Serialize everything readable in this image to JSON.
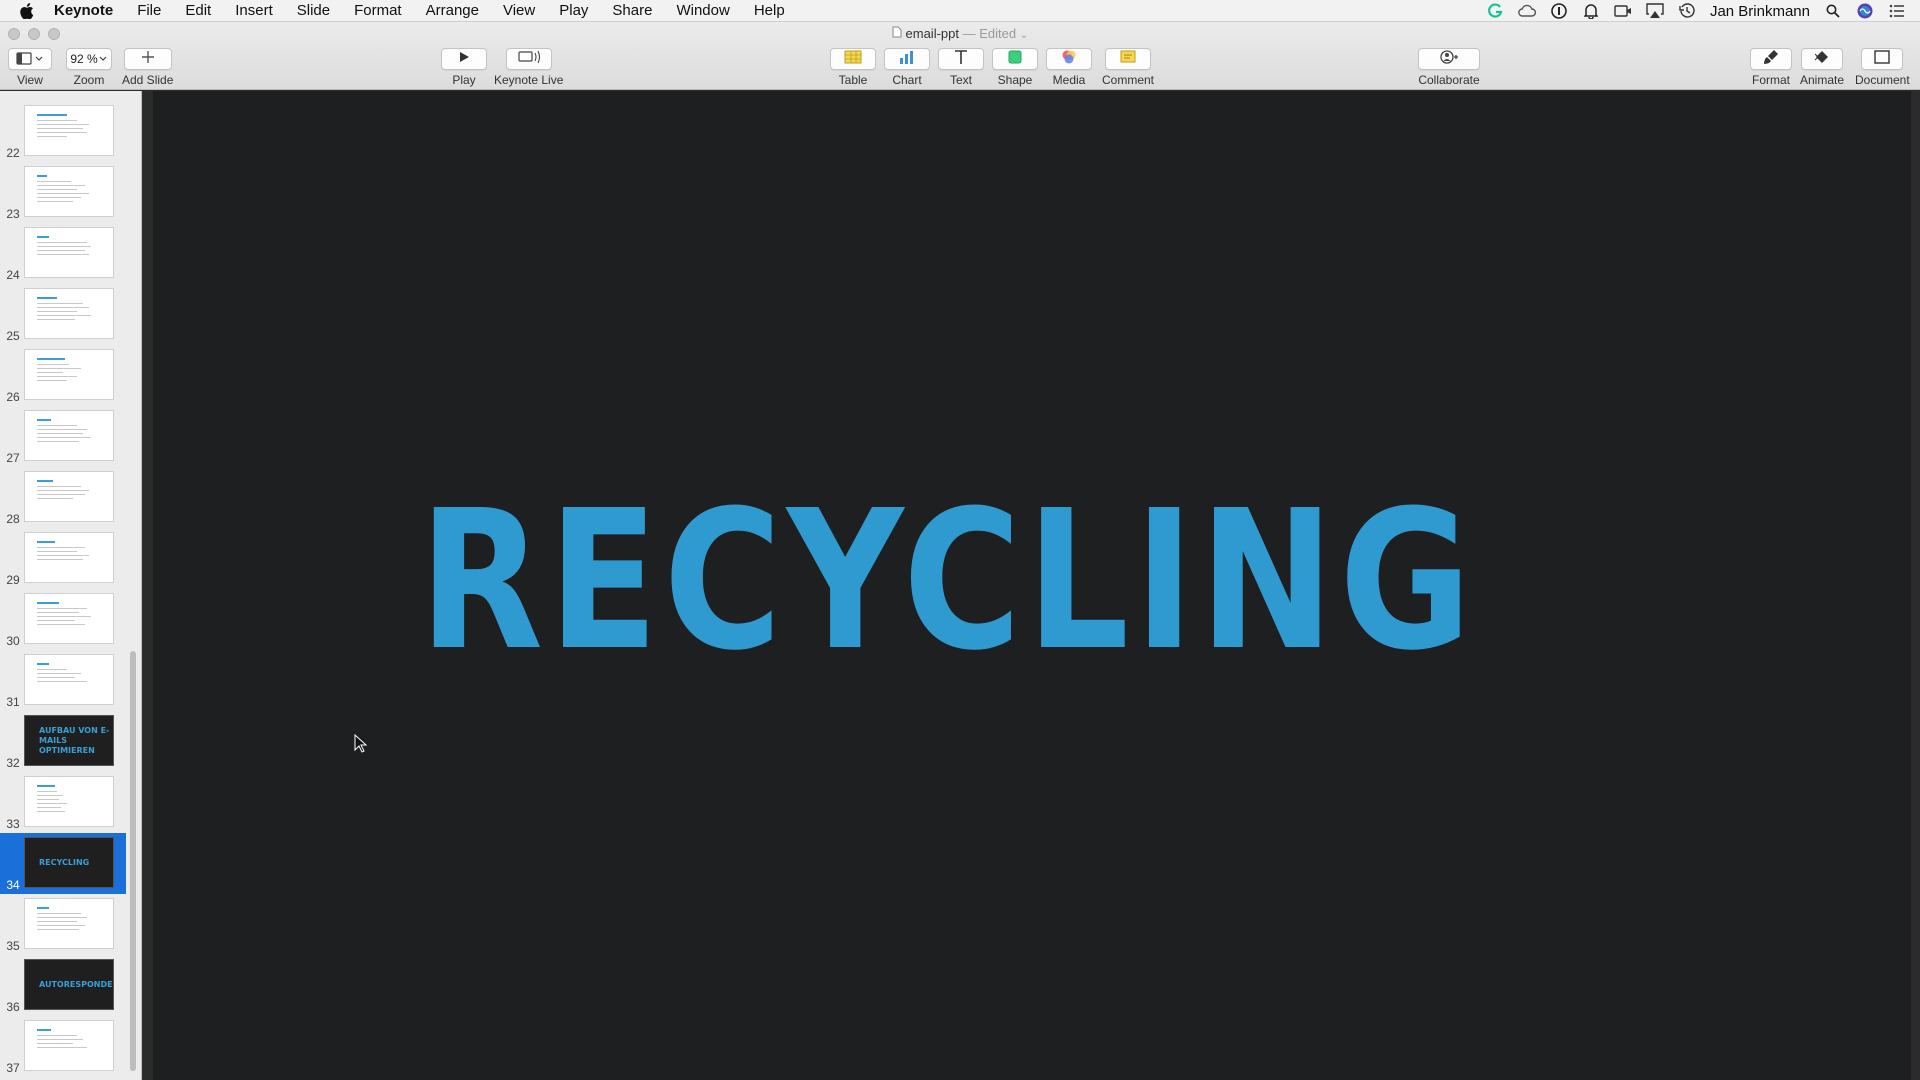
{
  "menubar": {
    "app_name": "Keynote",
    "items": [
      "File",
      "Edit",
      "Insert",
      "Slide",
      "Format",
      "Arrange",
      "View",
      "Play",
      "Share",
      "Window",
      "Help"
    ],
    "user": "Jan Brinkmann"
  },
  "window": {
    "doc_name": "email-ppt",
    "separator": " — ",
    "status": "Edited"
  },
  "toolbar": {
    "view": "View",
    "zoom": "Zoom",
    "zoom_value": "92 %",
    "add_slide": "Add Slide",
    "play": "Play",
    "keynote_live": "Keynote Live",
    "table": "Table",
    "chart": "Chart",
    "text": "Text",
    "shape": "Shape",
    "media": "Media",
    "comment": "Comment",
    "collaborate": "Collaborate",
    "format": "Format",
    "animate": "Animate",
    "document": "Document"
  },
  "slides": [
    {
      "number": "22",
      "kind": "light"
    },
    {
      "number": "23",
      "kind": "light"
    },
    {
      "number": "24",
      "kind": "light"
    },
    {
      "number": "25",
      "kind": "light"
    },
    {
      "number": "26",
      "kind": "light"
    },
    {
      "number": "27",
      "kind": "light"
    },
    {
      "number": "28",
      "kind": "light"
    },
    {
      "number": "29",
      "kind": "light"
    },
    {
      "number": "30",
      "kind": "light"
    },
    {
      "number": "31",
      "kind": "light"
    },
    {
      "number": "32",
      "kind": "dark",
      "thumb_text": "AUFBAU VON E-MAILS OPTIMIEREN"
    },
    {
      "number": "33",
      "kind": "light"
    },
    {
      "number": "34",
      "kind": "dark",
      "thumb_text": "RECYCLING",
      "selected": true
    },
    {
      "number": "35",
      "kind": "light"
    },
    {
      "number": "36",
      "kind": "dark",
      "thumb_text": "AUTORESPONDER"
    },
    {
      "number": "37",
      "kind": "light"
    }
  ],
  "current_slide": {
    "title": "RECYCLING"
  },
  "colors": {
    "accent": "#2f9ad0",
    "selection": "#1a6fd8",
    "slide_bg": "#1e1f20"
  }
}
